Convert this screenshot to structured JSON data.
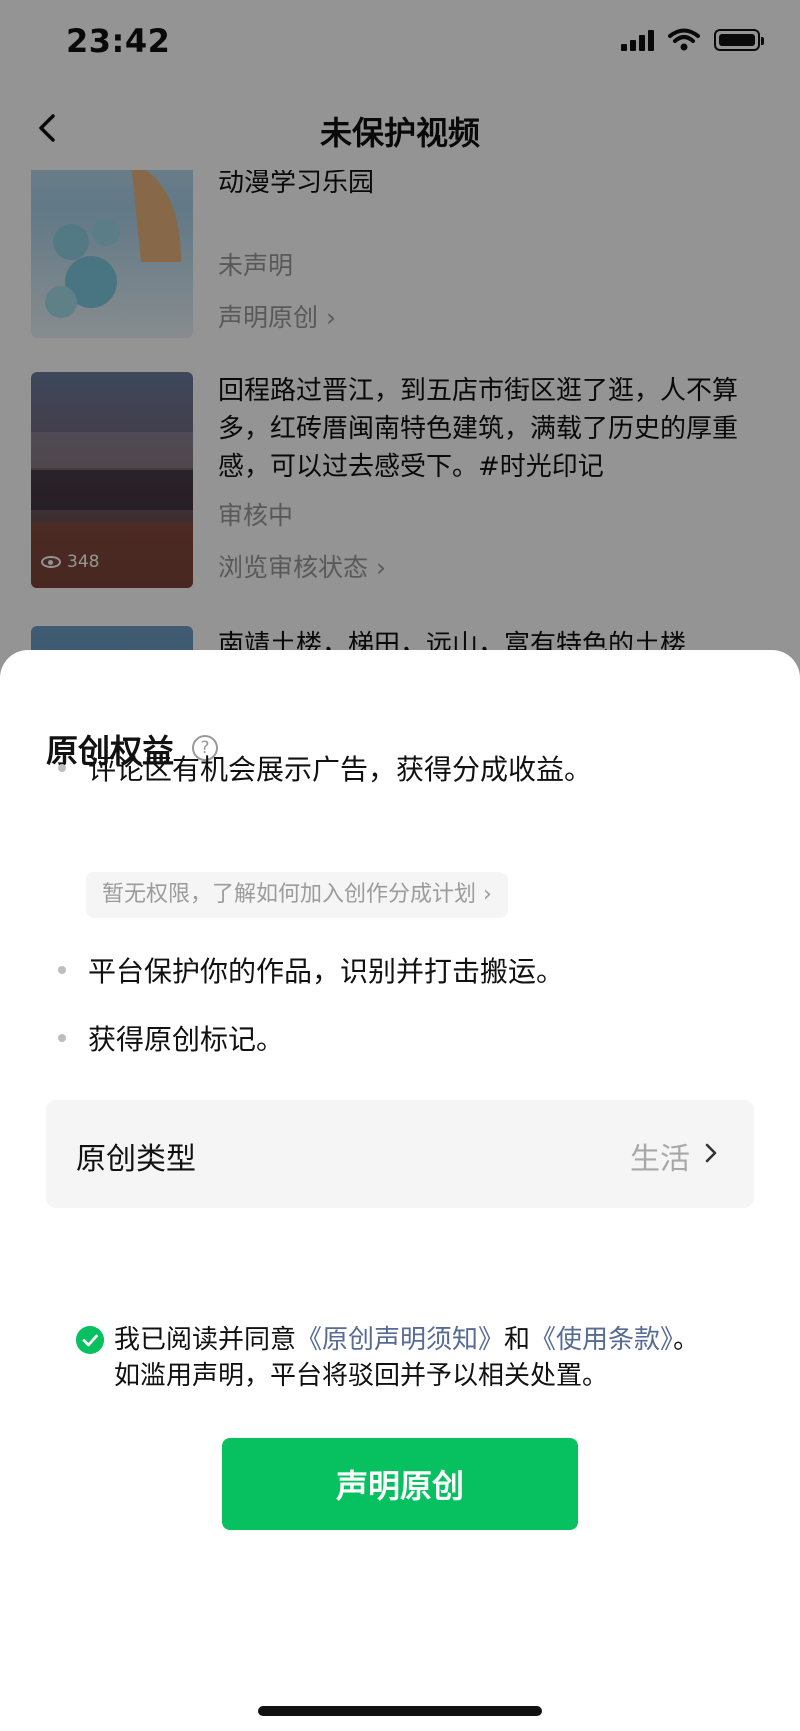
{
  "status_bar": {
    "time": "23:42"
  },
  "nav": {
    "title": "未保护视频"
  },
  "videos": [
    {
      "title": "王增雨，一个故事了解二氧化碳性质#分之道\n动漫学习乐园",
      "status": "未声明",
      "action": "声明原创 ›"
    },
    {
      "title": "回程路过晋江，到五店市街区逛了逛，人不算多，红砖厝闽南特色建筑，满载了历史的厚重感，可以过去感受下。#时光印记",
      "status": "审核中",
      "action": "浏览审核状态 ›",
      "views": "348"
    },
    {
      "title": "南靖土楼，梯田，远山，富有特色的土楼"
    }
  ],
  "sheet": {
    "title": "原创权益",
    "help_icon": "?",
    "benefits": [
      "评论区有机会展示广告，获得分成收益。",
      "平台保护你的作品，识别并打击搬运。",
      "获得原创标记。"
    ],
    "permission_note": "暂无权限，了解如何加入创作分成计划 ›",
    "type_label": "原创类型",
    "type_value": "生活",
    "agreement": {
      "prefix": "我已阅读并同意",
      "link1": "《原创声明须知》",
      "middle": "和",
      "link2": "《使用条款》",
      "suffix": "。",
      "line2": "如滥用声明，平台将驳回并予以相关处置。"
    },
    "primary_button": "声明原创"
  },
  "colors": {
    "accent": "#07c160",
    "link": "#576b95"
  }
}
